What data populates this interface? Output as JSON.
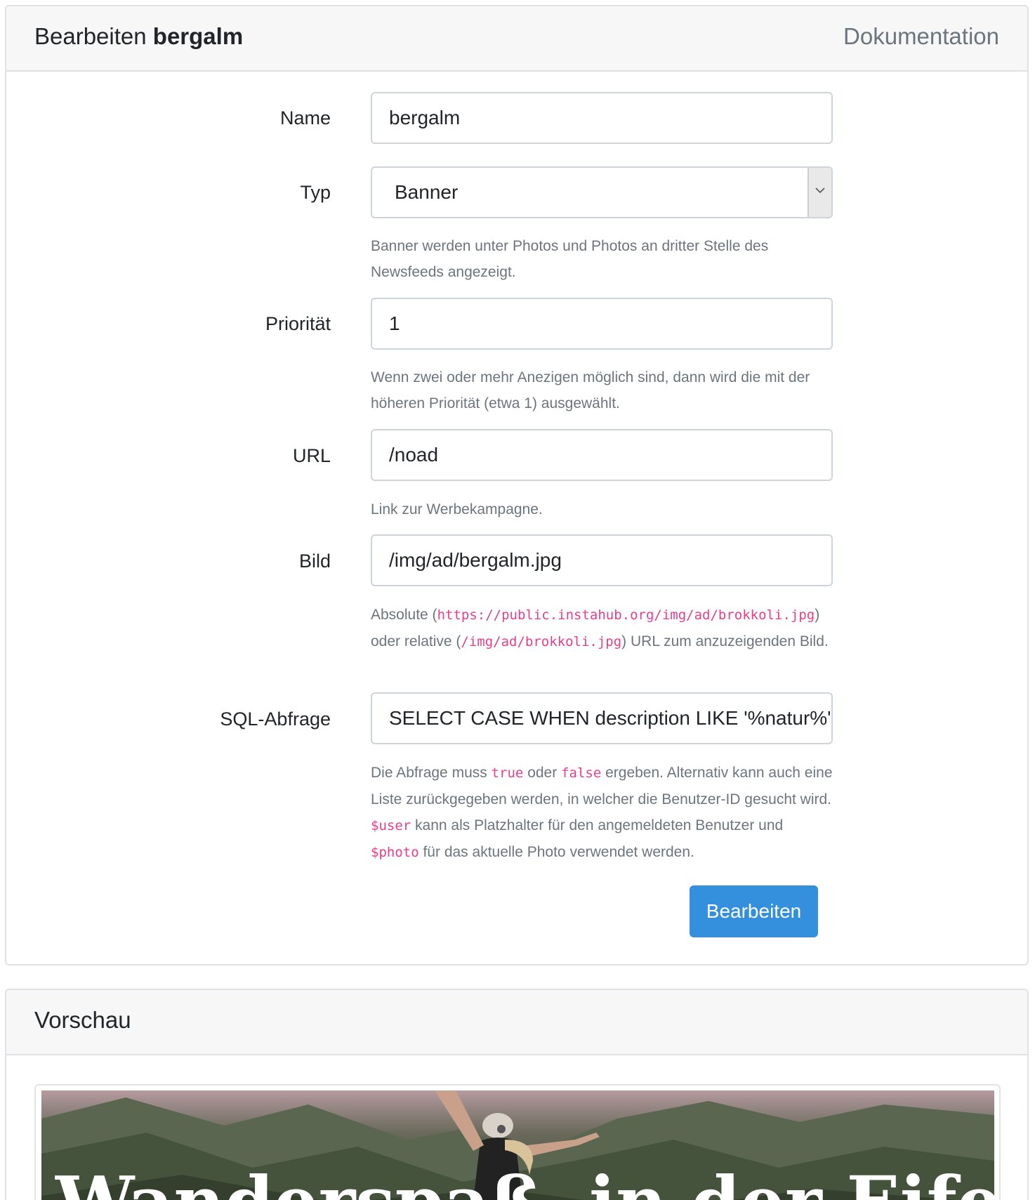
{
  "edit_card": {
    "title_prefix": "Bearbeiten",
    "title_name": "bergalm",
    "doc_link": "Dokumentation"
  },
  "form": {
    "name": {
      "label": "Name",
      "value": "bergalm"
    },
    "typ": {
      "label": "Typ",
      "value": "Banner",
      "help": "Banner werden unter Photos und Photos an dritter Stelle des Newsfeeds angezeigt."
    },
    "prioritaet": {
      "label": "Priorität",
      "value": "1",
      "help": "Wenn zwei oder mehr Anezigen möglich sind, dann wird die mit der höheren Priorität (etwa 1) ausgewählt."
    },
    "url": {
      "label": "URL",
      "value": "/noad",
      "help": "Link zur Werbekampagne."
    },
    "bild": {
      "label": "Bild",
      "value": "/img/ad/bergalm.jpg",
      "help_1": "Absolute (",
      "help_code_1": "https://public.instahub.org/img/ad/brokkoli.jpg",
      "help_2": ") oder relative (",
      "help_code_2": "/img/ad/brokkoli.jpg",
      "help_3": ") URL zum anzuzeigenden Bild."
    },
    "sql": {
      "label": "SQL-Abfrage",
      "value": "SELECT CASE WHEN description LIKE '%natur%' OR",
      "help_1": "Die Abfrage muss ",
      "help_code_true": "true",
      "help_2": " oder ",
      "help_code_false": "false",
      "help_3": " ergeben. Alternativ kann auch eine Liste zurückgegeben werden, in welcher die Benutzer-ID gesucht wird. ",
      "help_code_user": "$user",
      "help_4": " kann als Platzhalter für den angemeldeten Benutzer und ",
      "help_code_photo": "$photo",
      "help_5": " für das aktuelle Photo verwendet werden."
    },
    "submit_label": "Bearbeiten"
  },
  "preview_card": {
    "title": "Vorschau",
    "banner_text_left": "Wanderspaß",
    "banner_text_right": "in der Eifel"
  },
  "colors": {
    "primary_button": "#3490dc",
    "code": "#e83e8c",
    "muted": "#6c757d"
  }
}
